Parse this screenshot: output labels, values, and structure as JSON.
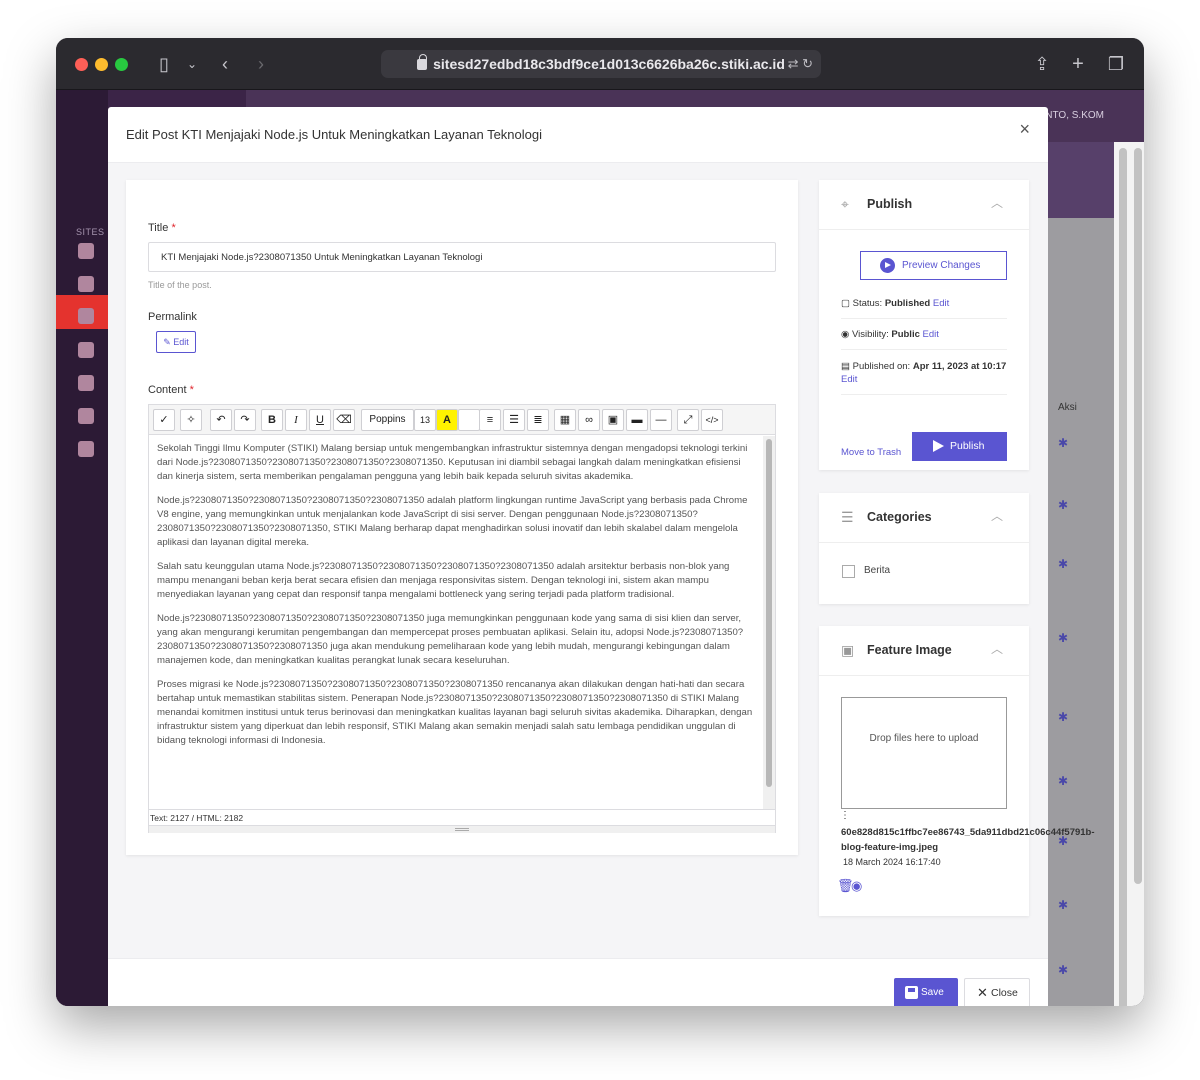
{
  "browser": {
    "url": "sitesd27edbd18c3bdf9ce1d013c6626ba26c.stiki.ac.id"
  },
  "background_app": {
    "sites_label": "SITES M",
    "user_name": "ANTO, S.KOM",
    "table_header_action": "Aksi"
  },
  "modal": {
    "title": "Edit Post KTI Menjajaki Node.js Untuk Meningkatkan Layanan Teknologi",
    "close_glyph": "×"
  },
  "form": {
    "title_label": "Title",
    "required_mark": "*",
    "title_value": "KTI Menjajaki Node.js?2308071350 Untuk Meningkatkan Layanan Teknologi",
    "title_help": "Title of the post.",
    "permalink_label": "Permalink",
    "permalink_edit": "Edit",
    "content_label": "Content"
  },
  "editor": {
    "font_name": "Poppins",
    "font_size": "13",
    "paragraphs": [
      "Sekolah Tinggi Ilmu Komputer (STIKI) Malang bersiap untuk mengembangkan infrastruktur sistemnya dengan mengadopsi teknologi terkini dari Node.js?2308071350?2308071350?2308071350?2308071350. Keputusan ini diambil sebagai langkah dalam meningkatkan efisiensi dan kinerja sistem, serta memberikan pengalaman pengguna yang lebih baik kepada seluruh sivitas akademika.",
      "Node.js?2308071350?2308071350?2308071350?2308071350 adalah platform lingkungan runtime JavaScript yang berbasis pada Chrome V8 engine, yang memungkinkan untuk menjalankan kode JavaScript di sisi server. Dengan penggunaan Node.js?2308071350?2308071350?2308071350?2308071350, STIKI Malang berharap dapat menghadirkan solusi inovatif dan lebih skalabel dalam mengelola aplikasi dan layanan digital mereka.",
      "Salah satu keunggulan utama Node.js?2308071350?2308071350?2308071350?2308071350 adalah arsitektur berbasis non-blok yang mampu menangani beban kerja berat secara efisien dan menjaga responsivitas sistem. Dengan teknologi ini, sistem akan mampu menyediakan layanan yang cepat dan responsif tanpa mengalami bottleneck  yang sering terjadi pada platform tradisional.",
      "Node.js?2308071350?2308071350?2308071350?2308071350 juga memungkinkan penggunaan kode yang sama di sisi klien dan server, yang akan mengurangi kerumitan pengembangan dan mempercepat proses pembuatan aplikasi. Selain itu, adopsi Node.js?2308071350?2308071350?2308071350?2308071350 juga akan mendukung pemeliharaan kode yang lebih mudah, mengurangi kebingungan dalam manajemen kode, dan meningkatkan kualitas perangkat lunak secara keseluruhan.",
      "Proses migrasi ke Node.js?2308071350?2308071350?2308071350?2308071350 rencananya akan dilakukan dengan hati-hati dan secara bertahap untuk memastikan stabilitas sistem. Penerapan Node.js?2308071350?2308071350?2308071350?2308071350 di STIKI Malang menandai komitmen institusi untuk terus berinovasi dan meningkatkan kualitas layanan bagi seluruh sivitas akademika. Diharapkan, dengan infrastruktur sistem yang diperkuat dan lebih responsif, STIKI Malang akan semakin menjadi salah satu lembaga pendidikan unggulan di bidang teknologi informasi di Indonesia."
    ],
    "status": "Text: 2127 / HTML: 2182"
  },
  "publish": {
    "title": "Publish",
    "preview_label": "Preview Changes",
    "status_prefix": "Status:",
    "status_value": "Published",
    "visibility_prefix": "Visibility:",
    "visibility_value": "Public",
    "published_prefix": "Published on:",
    "published_value": "Apr 11, 2023 at 10:17",
    "edit_link": "Edit",
    "trash_label": "Move to Trash",
    "publish_label": "Publish"
  },
  "categories": {
    "title": "Categories",
    "items": [
      "Berita"
    ]
  },
  "feature_image": {
    "title": "Feature Image",
    "dropzone_text": "Drop files here to upload",
    "file_name": "60e828d815c1ffbc7ee86743_5da911dbd21c06c44f5791b-blog-feature-img.jpeg",
    "file_date": "18 March 2024 16:17:40"
  },
  "footer": {
    "save_label": "Save",
    "close_label": "Close"
  },
  "colors": {
    "accent": "#5a55d1",
    "required": "#e0252c"
  }
}
